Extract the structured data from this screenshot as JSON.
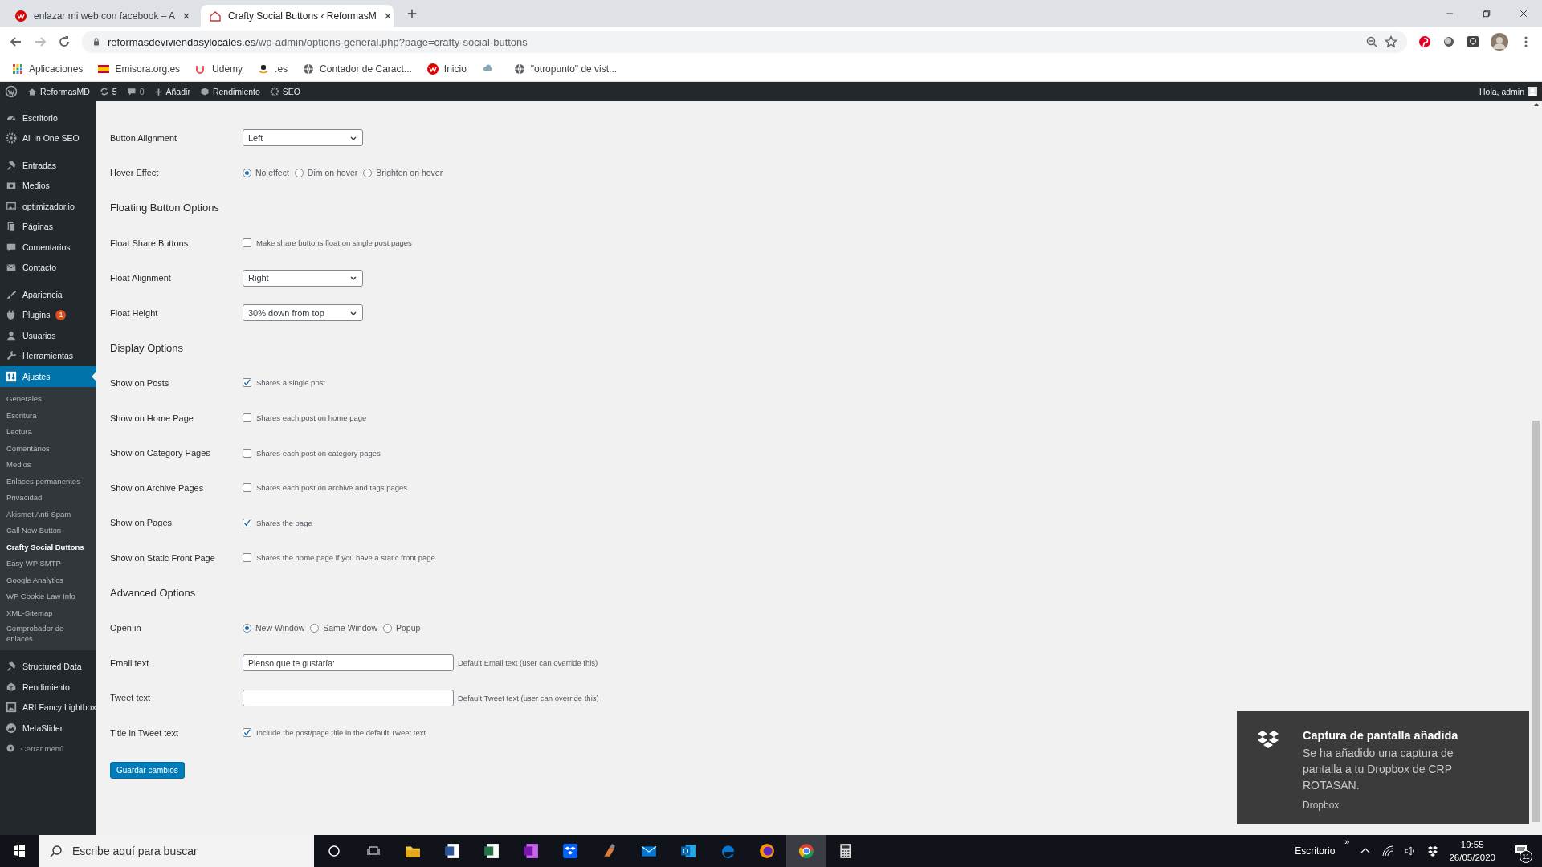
{
  "browser": {
    "tabs": [
      {
        "title": "enlazar mi web con facebook – A",
        "selected": false
      },
      {
        "title": "Crafty Social Buttons ‹ ReformasM",
        "selected": true
      }
    ],
    "url_host": "reformasdeviviendasylocales.es",
    "url_path": "/wp-admin/options-general.php?page=crafty-social-buttons",
    "bookmarks": [
      "Aplicaciones",
      "Emisora.org.es",
      "Udemy",
      ".es",
      "Contador de Caract...",
      "Inicio",
      "\"otropunto\" de vist..."
    ]
  },
  "admin_bar": {
    "site": "ReformasMD",
    "updates": "5",
    "comments": "0",
    "new": "Añadir",
    "items": [
      "Rendimiento",
      "SEO"
    ],
    "greeting": "Hola, admin"
  },
  "sidebar": {
    "items": [
      {
        "label": "Escritorio",
        "selected": false
      },
      {
        "label": "All in One SEO",
        "selected": false
      },
      {
        "label": "Entradas",
        "selected": false
      },
      {
        "label": "Medios",
        "selected": false
      },
      {
        "label": "optimizador.io",
        "selected": false
      },
      {
        "label": "Páginas",
        "selected": false
      },
      {
        "label": "Comentarios",
        "selected": false
      },
      {
        "label": "Contacto",
        "selected": false
      },
      {
        "label": "Apariencia",
        "selected": false
      },
      {
        "label": "Plugins",
        "selected": false,
        "badge": "1"
      },
      {
        "label": "Usuarios",
        "selected": false
      },
      {
        "label": "Herramientas",
        "selected": false
      },
      {
        "label": "Ajustes",
        "selected": true
      }
    ],
    "submenu": [
      {
        "label": "Generales",
        "selected": false
      },
      {
        "label": "Escritura",
        "selected": false
      },
      {
        "label": "Lectura",
        "selected": false
      },
      {
        "label": "Comentarios",
        "selected": false
      },
      {
        "label": "Medios",
        "selected": false
      },
      {
        "label": "Enlaces permanentes",
        "selected": false
      },
      {
        "label": "Privacidad",
        "selected": false
      },
      {
        "label": "Akismet Anti-Spam",
        "selected": false
      },
      {
        "label": "Call Now Button",
        "selected": false
      },
      {
        "label": "Crafty Social Buttons",
        "selected": true
      },
      {
        "label": "Easy WP SMTP",
        "selected": false
      },
      {
        "label": "Google Analytics",
        "selected": false
      },
      {
        "label": "WP Cookie Law Info",
        "selected": false
      },
      {
        "label": "XML-Sitemap",
        "selected": false
      },
      {
        "label": "Comprobador de enlaces",
        "selected": false
      }
    ],
    "more_items": [
      {
        "label": "Structured Data",
        "selected": false
      },
      {
        "label": "Rendimiento",
        "selected": false
      },
      {
        "label": "ARI Fancy Lightbox",
        "selected": false
      },
      {
        "label": "MetaSlider",
        "selected": false
      }
    ],
    "collapse": "Cerrar menú"
  },
  "form": {
    "rows": [
      {
        "kind": "select",
        "label": "Button Alignment",
        "value": "Left"
      },
      {
        "kind": "radio",
        "label": "Hover Effect",
        "options": [
          {
            "label": "No effect",
            "selected": true
          },
          {
            "label": "Dim on hover",
            "selected": false
          },
          {
            "label": "Brighten on hover",
            "selected": false
          }
        ]
      },
      {
        "kind": "heading",
        "label": "Floating Button Options"
      },
      {
        "kind": "checkbox",
        "label": "Float Share Buttons",
        "text": "Make share buttons float on single post pages",
        "checked": false
      },
      {
        "kind": "select",
        "label": "Float Alignment",
        "value": "Right"
      },
      {
        "kind": "select",
        "label": "Float Height",
        "value": "30% down from top"
      },
      {
        "kind": "heading",
        "label": "Display Options"
      },
      {
        "kind": "checkbox",
        "label": "Show on Posts",
        "text": "Shares a single post",
        "checked": true
      },
      {
        "kind": "checkbox",
        "label": "Show on Home Page",
        "text": "Shares each post on home page",
        "checked": false
      },
      {
        "kind": "checkbox",
        "label": "Show on Category Pages",
        "text": "Shares each post on category pages",
        "checked": false
      },
      {
        "kind": "checkbox",
        "label": "Show on Archive Pages",
        "text": "Shares each post on archive and tags pages",
        "checked": false
      },
      {
        "kind": "checkbox",
        "label": "Show on Pages",
        "text": "Shares the page",
        "checked": true
      },
      {
        "kind": "checkbox",
        "label": "Show on Static Front Page",
        "text": "Shares the home page if you have a static front page",
        "checked": false
      },
      {
        "kind": "heading",
        "label": "Advanced Options"
      },
      {
        "kind": "radio",
        "label": "Open in",
        "options": [
          {
            "label": "New Window",
            "selected": true
          },
          {
            "label": "Same Window",
            "selected": false
          },
          {
            "label": "Popup",
            "selected": false
          }
        ]
      },
      {
        "kind": "text",
        "label": "Email text",
        "value": "Pienso que te gustaría:",
        "description": "Default Email text (user can override this)"
      },
      {
        "kind": "text",
        "label": "Tweet text",
        "description": "Default Tweet text (user can override this)"
      },
      {
        "kind": "checkbox",
        "label": "Title in Tweet text",
        "text": "Include the post/page title in the default Tweet text",
        "checked": true
      }
    ],
    "save_button": "Guardar cambios"
  },
  "notification": {
    "title": "Captura de pantalla añadida",
    "body": "Se ha añadido una captura de pantalla a tu Dropbox de CRP ROTASAN.",
    "source": "Dropbox"
  },
  "taskbar": {
    "search_placeholder": "Escribe aquí para buscar",
    "desktop": "Escritorio",
    "more": "»",
    "time": "19:55",
    "date": "26/05/2020",
    "notifications": "11"
  }
}
